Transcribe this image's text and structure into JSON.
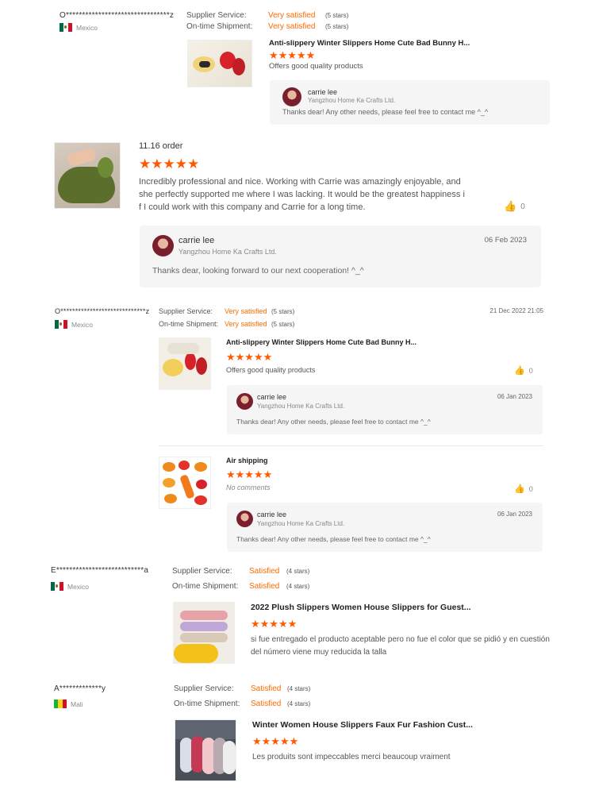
{
  "labels": {
    "supplier_service": "Supplier Service:",
    "ontime_shipment": "On-time Shipment:"
  },
  "reviews": [
    {
      "buyer": "O********************************z",
      "country": "Mexico",
      "supplier_value": "Very satisfied",
      "supplier_stars": "(5 stars)",
      "shipment_value": "Very satisfied",
      "shipment_stars": "(5 stars)",
      "product_title": "Anti-slippery Winter Slippers Home Cute Bad Bunny H...",
      "stars": "★★★★★",
      "text": "Offers good quality products",
      "reply": {
        "name": "carrie lee",
        "company": "Yangzhou Home Ka Crafts Ltd.",
        "message": "Thanks dear! Any other needs, please feel free to contact me ^_^"
      }
    },
    {
      "order_label": "11.16 order",
      "stars": "★★★★★",
      "text": "Incredibly professional and nice. Working with Carrie was amazingly enjoyable, and she perfectly supported me where I was lacking. It would be the greatest happiness if I could work with this company and Carrie for a long time.",
      "likes": "0",
      "reply": {
        "name": "carrie lee",
        "company": "Yangzhou Home Ka Crafts Ltd.",
        "date": "06 Feb 2023",
        "message": "Thanks dear, looking forward to our next cooperation! ^_^"
      }
    },
    {
      "buyer": "O*****************************z",
      "country": "Mexico",
      "date": "21 Dec 2022 21:05",
      "supplier_value": "Very satisfied",
      "supplier_stars": "(5 stars)",
      "shipment_value": "Very satisfied",
      "shipment_stars": "(5 stars)",
      "items": [
        {
          "product_title": "Anti-slippery Winter Slippers Home Cute Bad Bunny H...",
          "stars": "★★★★★",
          "text": "Offers good quality products",
          "likes": "0",
          "reply": {
            "name": "carrie lee",
            "company": "Yangzhou Home Ka Crafts Ltd.",
            "date": "06 Jan 2023",
            "message": "Thanks dear! Any other needs, please feel free to contact me ^_^"
          }
        },
        {
          "product_title": "Air shipping",
          "stars": "★★★★★",
          "text": "No comments",
          "likes": "0",
          "reply": {
            "name": "carrie lee",
            "company": "Yangzhou Home Ka Crafts Ltd.",
            "date": "06 Jan 2023",
            "message": "Thanks dear! Any other needs, please feel free to contact me ^_^"
          }
        }
      ]
    },
    {
      "buyer": "E***************************a",
      "country": "Mexico",
      "supplier_value": "Satisfied",
      "supplier_stars": "(4 stars)",
      "shipment_value": "Satisfied",
      "shipment_stars": "(4 stars)",
      "product_title": "2022 Plush Slippers Women House Slippers for Guest...",
      "stars": "★★★★★",
      "text": "si fue entregado el producto aceptable pero no fue el color que se pidió y en cuestión del número viene muy reducida la talla"
    },
    {
      "buyer": "A*************y",
      "country": "Mali",
      "supplier_value": "Satisfied",
      "supplier_stars": "(4 stars)",
      "shipment_value": "Satisfied",
      "shipment_stars": "(4 stars)",
      "product_title": "Winter Women House Slippers Faux Fur Fashion Cust...",
      "stars": "★★★★★",
      "text": "Les produits sont impeccables merci beaucoup vraiment"
    }
  ],
  "icons": {
    "like": "thumbs-up-icon"
  },
  "colors": {
    "accent": "#ff6a00",
    "star": "#ff5a00"
  }
}
